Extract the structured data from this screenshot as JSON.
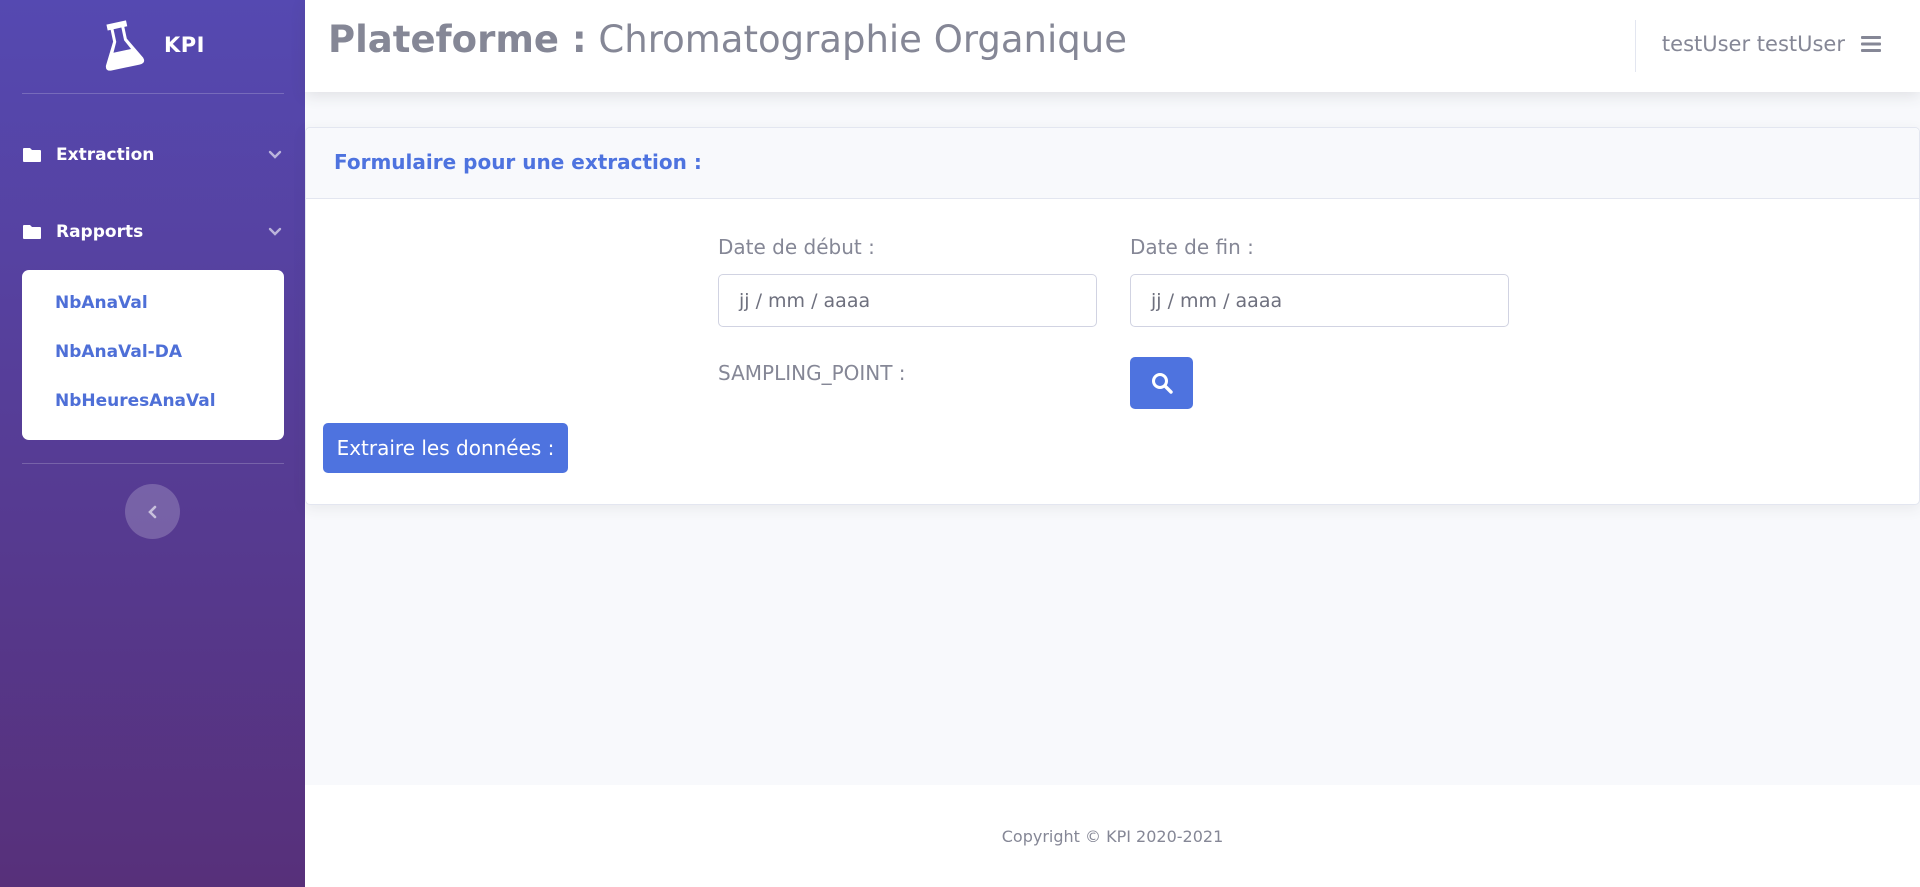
{
  "brand": {
    "name": "KPI",
    "icon": "flask-icon"
  },
  "sidebar": {
    "items": [
      {
        "label": "Extraction",
        "icon": "folder-icon",
        "expand_icon": "chevron-down-icon"
      },
      {
        "label": "Rapports",
        "icon": "folder-icon",
        "expand_icon": "chevron-down-icon"
      }
    ],
    "submenu": [
      {
        "label": "NbAnaVal"
      },
      {
        "label": "NbAnaVal-DA"
      },
      {
        "label": "NbHeuresAnaVal"
      }
    ],
    "toggle_icon": "chevron-left-icon"
  },
  "topbar": {
    "title_prefix": "Plateforme :",
    "title": "Chromatographie Organique",
    "user_name": "testUser testUser",
    "menu_icon": "bars-icon"
  },
  "form": {
    "title": "Formulaire pour une extraction :",
    "start_date_label": "Date de début :",
    "start_date_value": "jj / mm / aaaa",
    "end_date_label": "Date de fin :",
    "end_date_value": "jj / mm / aaaa",
    "sampling_point_label": "SAMPLING_POINT :",
    "search_icon": "search-icon",
    "extract_button": "Extraire les données :"
  },
  "footer": {
    "copyright": "Copyright © KPI 2020-2021"
  },
  "colors": {
    "primary": "#4e73df",
    "sidebar_top": "#5549b1",
    "sidebar_bottom": "#57307a",
    "text_muted": "#858796"
  }
}
